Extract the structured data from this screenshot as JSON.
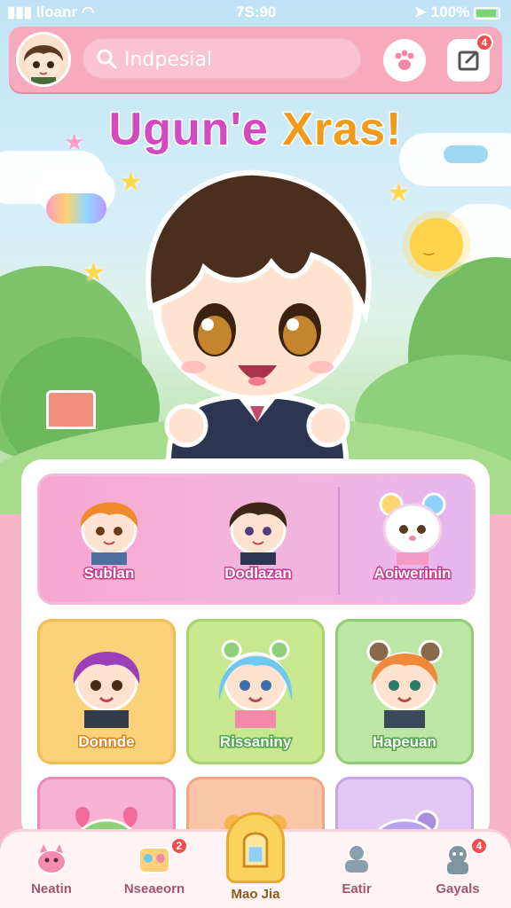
{
  "status_bar": {
    "carrier": "Iloanr",
    "time": "7S:90",
    "battery": "100%"
  },
  "header": {
    "search": {
      "value": "Indpesial"
    },
    "notification_badge": "4"
  },
  "title": {
    "part1": "Ugun'e",
    "part2": "Xras!"
  },
  "featured": [
    {
      "label": "Sublan"
    },
    {
      "label": "Dodlazan"
    },
    {
      "label": "Aoiwerinin"
    }
  ],
  "cards": [
    {
      "label": "Donnde",
      "color": "#fbd27a"
    },
    {
      "label": "Rissaniny",
      "color": "#c8e88f"
    },
    {
      "label": "Hapeuan",
      "color": "#bde5a6"
    }
  ],
  "bottom_nav": [
    {
      "label": "Neatin",
      "badge": ""
    },
    {
      "label": "Nseaeorn",
      "badge": "2"
    },
    {
      "label": "Mao Jia",
      "badge": "",
      "active": true
    },
    {
      "label": "Eatir",
      "badge": ""
    },
    {
      "label": "Gayals",
      "badge": "4"
    }
  ],
  "colors": {
    "pink_bar": "#f7a9bd",
    "title_magenta": "#d14ac0",
    "title_orange": "#f29a1b",
    "active_tab": "#fbd25c"
  }
}
